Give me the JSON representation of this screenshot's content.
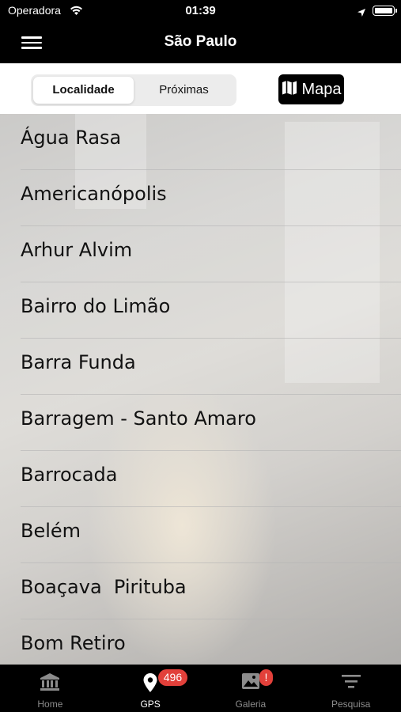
{
  "status_bar": {
    "carrier": "Operadora",
    "time": "01:39",
    "icons": [
      "wifi-icon",
      "location-arrow-icon",
      "battery-icon"
    ]
  },
  "nav": {
    "title": "São Paulo",
    "menu_icon": "hamburger-menu-icon"
  },
  "toolbar": {
    "segments": [
      {
        "label": "Localidade",
        "selected": true
      },
      {
        "label": "Próximas",
        "selected": false
      }
    ],
    "map_button": {
      "label": "Mapa",
      "icon": "map-icon"
    }
  },
  "list": {
    "items": [
      "Água Rasa",
      "Americanópolis",
      "Arhur Alvim",
      "Bairro do Limão",
      "Barra Funda",
      "Barragem - Santo Amaro",
      "Barrocada",
      "Belém",
      "Boaçava  Pirituba",
      "Bom Retiro"
    ]
  },
  "tab_bar": {
    "tabs": [
      {
        "label": "Home",
        "icon": "bank-building-icon",
        "active": false,
        "badge": ""
      },
      {
        "label": "GPS",
        "icon": "map-pin-icon",
        "active": true,
        "badge": "496"
      },
      {
        "label": "Galeria",
        "icon": "image-gallery-icon",
        "active": false,
        "badge": "!"
      },
      {
        "label": "Pesquisa",
        "icon": "filter-icon",
        "active": false,
        "badge": ""
      }
    ]
  },
  "colors": {
    "bar_background": "#000000",
    "badge": "#e2403a",
    "tab_inactive": "#8c8c8c"
  }
}
